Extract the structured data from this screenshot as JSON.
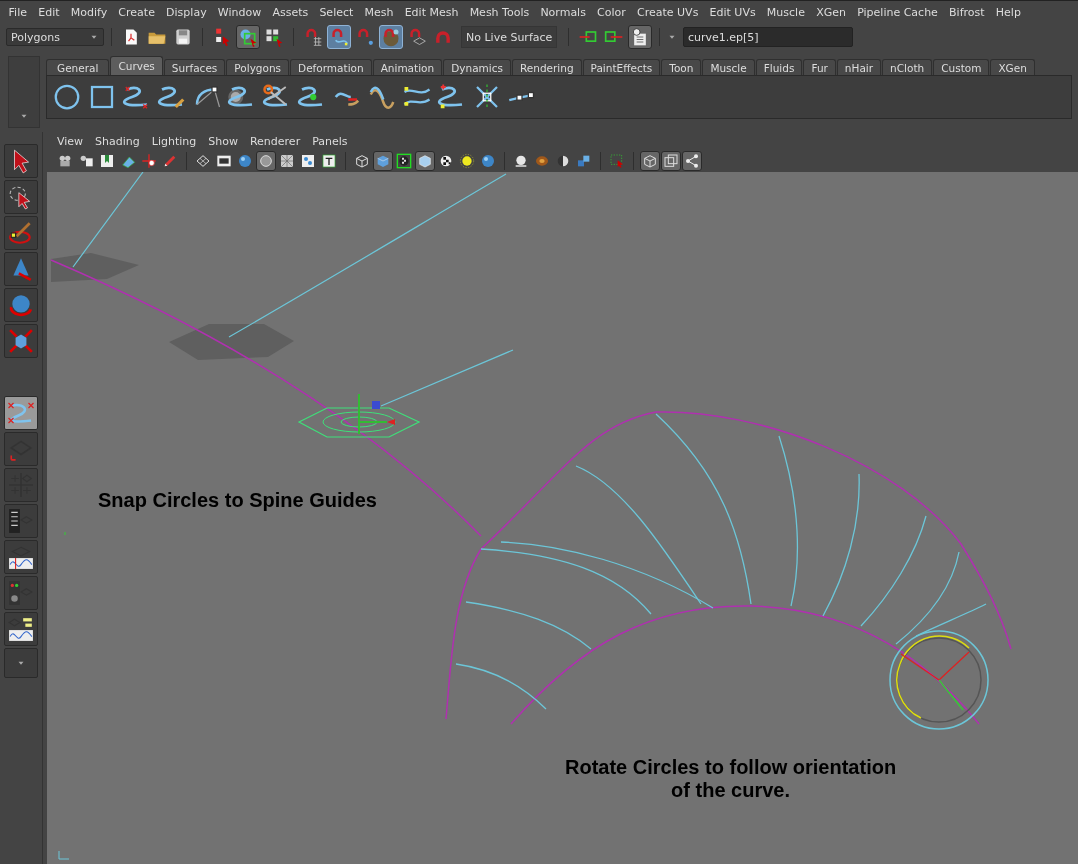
{
  "menu_bar": [
    "File",
    "Edit",
    "Modify",
    "Create",
    "Display",
    "Window",
    "Assets",
    "Select",
    "Mesh",
    "Edit Mesh",
    "Mesh Tools",
    "Normals",
    "Color",
    "Create UVs",
    "Edit UVs",
    "Muscle",
    "XGen",
    "Pipeline Cache",
    "Bifrost",
    "Help"
  ],
  "status_line": {
    "mode_menu": "Polygons",
    "file_tools": [
      {
        "kind": "page",
        "selected": false
      },
      {
        "kind": "folder",
        "selected": false
      },
      {
        "kind": "disk",
        "selected": false
      }
    ],
    "select_tools": [
      {
        "kind": "pick-hierarchy",
        "selected": false
      },
      {
        "kind": "pick-object",
        "selected": true
      },
      {
        "kind": "pick-component",
        "selected": false
      }
    ],
    "snap_tools": [
      {
        "kind": "magnet-grid",
        "selected": false
      },
      {
        "kind": "magnet-curve",
        "selected": true
      },
      {
        "kind": "magnet-point",
        "selected": false
      },
      {
        "kind": "magnet-surface",
        "selected": true
      },
      {
        "kind": "magnet-plane",
        "selected": false
      },
      {
        "kind": "magnet",
        "selected": false
      }
    ],
    "live_surface": "No Live Surface",
    "history_tools": [
      {
        "kind": "input-arrow",
        "selected": false
      },
      {
        "kind": "output-arrow",
        "selected": false
      },
      {
        "kind": "history",
        "selected": true
      }
    ],
    "selection_field": "curve1.ep[5]"
  },
  "shelf": {
    "tabs": [
      {
        "label": "General",
        "selected": false
      },
      {
        "label": "Curves",
        "selected": true
      },
      {
        "label": "Surfaces",
        "selected": false
      },
      {
        "label": "Polygons",
        "selected": false
      },
      {
        "label": "Deformation",
        "selected": false
      },
      {
        "label": "Animation",
        "selected": false
      },
      {
        "label": "Dynamics",
        "selected": false
      },
      {
        "label": "Rendering",
        "selected": false
      },
      {
        "label": "PaintEffects",
        "selected": false
      },
      {
        "label": "Toon",
        "selected": false
      },
      {
        "label": "Muscle",
        "selected": false
      },
      {
        "label": "Fluids",
        "selected": false
      },
      {
        "label": "Fur",
        "selected": false
      },
      {
        "label": "nHair",
        "selected": false
      },
      {
        "label": "nCloth",
        "selected": false
      },
      {
        "label": "Custom",
        "selected": false
      },
      {
        "label": "XGen",
        "selected": false
      }
    ],
    "tools": [
      {
        "kind": "circle"
      },
      {
        "kind": "square"
      },
      {
        "kind": "curve-cv"
      },
      {
        "kind": "curve-pencil"
      },
      {
        "kind": "arc"
      },
      {
        "kind": "tape"
      },
      {
        "kind": "scissors"
      },
      {
        "kind": "curve-dot"
      },
      {
        "kind": "curve-arrow"
      },
      {
        "kind": "wave"
      },
      {
        "kind": "curves-cv"
      },
      {
        "kind": "curve-points"
      },
      {
        "kind": "curve-bend"
      },
      {
        "kind": "curve-anchors"
      }
    ]
  },
  "panel": {
    "menu": [
      "View",
      "Shading",
      "Lighting",
      "Show",
      "Renderer",
      "Panels"
    ],
    "toolbar": [
      {
        "kind": "camera",
        "selected": false
      },
      {
        "kind": "camera-sheet",
        "selected": false
      },
      {
        "kind": "book",
        "selected": false
      },
      {
        "kind": "image-plane",
        "selected": false
      },
      {
        "kind": "pan",
        "selected": false
      },
      {
        "kind": "pencil",
        "selected": false
      },
      {
        "kind": "sep"
      },
      {
        "kind": "grid",
        "selected": false
      },
      {
        "kind": "film",
        "selected": false
      },
      {
        "kind": "sphere-blue",
        "selected": false
      },
      {
        "kind": "circle-gray",
        "selected": true
      },
      {
        "kind": "grid-x",
        "selected": false
      },
      {
        "kind": "dots",
        "selected": false
      },
      {
        "kind": "text-box",
        "selected": false
      },
      {
        "kind": "sep"
      },
      {
        "kind": "cube-wire",
        "selected": false
      },
      {
        "kind": "cube-shaded",
        "selected": true
      },
      {
        "kind": "checker-framed",
        "selected": false
      },
      {
        "kind": "cube-light",
        "selected": true
      },
      {
        "kind": "checker",
        "selected": false
      },
      {
        "kind": "sun",
        "selected": false
      },
      {
        "kind": "sphere-blue",
        "selected": false
      },
      {
        "kind": "sep"
      },
      {
        "kind": "sphere-white",
        "selected": false
      },
      {
        "kind": "sphere-brown",
        "selected": false
      },
      {
        "kind": "half-sphere",
        "selected": false
      },
      {
        "kind": "cubes",
        "selected": false
      },
      {
        "kind": "sep"
      },
      {
        "kind": "select-box",
        "selected": false
      },
      {
        "kind": "sep"
      },
      {
        "kind": "cube-wire",
        "selected": true
      },
      {
        "kind": "isolate",
        "selected": true
      },
      {
        "kind": "share",
        "selected": true
      }
    ]
  },
  "toolbox": [
    {
      "kind": "select",
      "selected": false
    },
    {
      "kind": "lasso",
      "selected": false
    },
    {
      "kind": "paint",
      "selected": false
    },
    {
      "kind": "move",
      "selected": false
    },
    {
      "kind": "rotate",
      "selected": false
    },
    {
      "kind": "scale",
      "selected": false
    },
    {
      "kind": "gap"
    },
    {
      "kind": "curve",
      "selected": true
    },
    {
      "kind": "single-view",
      "selected": false
    },
    {
      "kind": "four-view",
      "selected": false
    },
    {
      "kind": "outliner-persp",
      "selected": false
    },
    {
      "kind": "persp-graph",
      "selected": false
    },
    {
      "kind": "hypershade-persp",
      "selected": false
    },
    {
      "kind": "persp-outliner-graph",
      "selected": false
    },
    {
      "kind": "more",
      "selected": false
    }
  ],
  "viewport": {
    "annotations": [
      "Snap Circles to Spine Guides",
      "Rotate Circles to follow orientation\nof the curve."
    ]
  }
}
